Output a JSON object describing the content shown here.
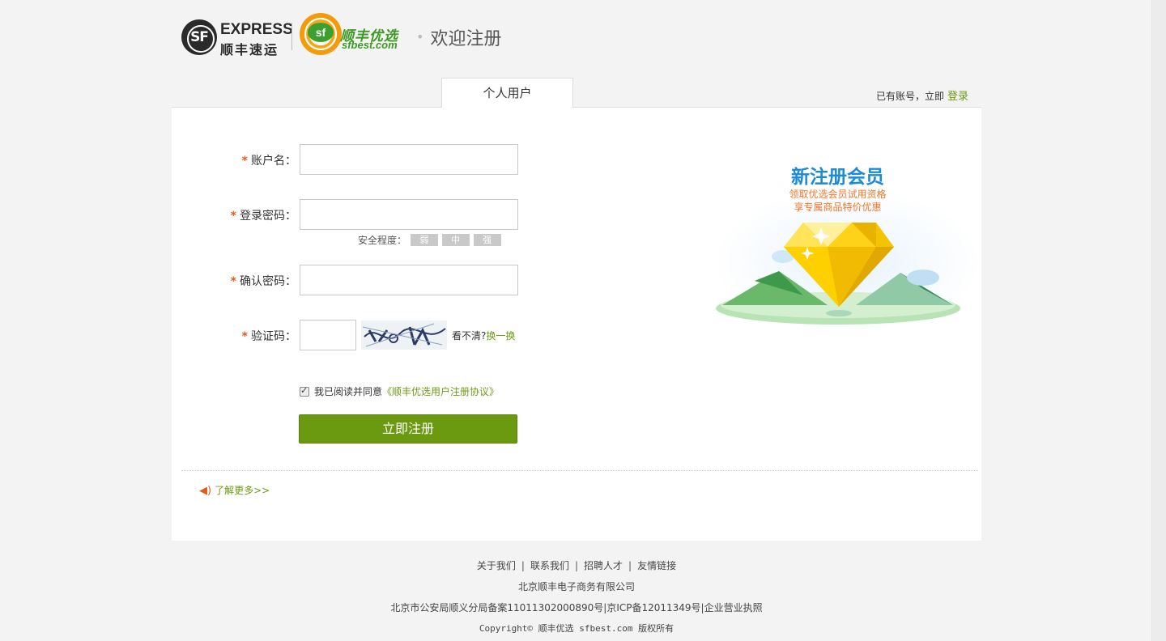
{
  "header": {
    "express_logo_text": "EXPRESS",
    "express_logo_cn": "顺丰速运",
    "sfbest_logo_cn": "顺丰优选",
    "sfbest_logo_url": "sfbest.com",
    "welcome": "欢迎注册"
  },
  "tabs": [
    {
      "label": "个人用户",
      "active": true
    }
  ],
  "login_hint": {
    "text": "已有账号，立即",
    "link": "登录"
  },
  "form": {
    "account": {
      "label": "账户名：",
      "value": ""
    },
    "password": {
      "label": "登录密码：",
      "value": ""
    },
    "strength": {
      "label": "安全程度：",
      "levels": [
        "弱",
        "中",
        "强"
      ]
    },
    "confirm": {
      "label": "确认密码：",
      "value": ""
    },
    "captcha": {
      "label": "验证码：",
      "value": "",
      "hint": "看不清?",
      "refresh": "换一换"
    },
    "agree": {
      "text": "我已阅读并同意",
      "link": "《顺丰优选用户注册协议》",
      "checked": true
    },
    "submit": "立即注册"
  },
  "promo": {
    "title": "新注册会员",
    "line1": "领取优选会员试用资格",
    "line2": "享专属商品特价优惠"
  },
  "more_link": "了解更多>>",
  "footer": {
    "links": [
      "关于我们",
      "联系我们",
      "招聘人才",
      "友情链接"
    ],
    "company": "北京顺丰电子商务有限公司",
    "icp": "北京市公安局顺义分局备案11011302000890号|京ICP备12011349号|企业营业执照",
    "copyright": "Copyright© 顺丰优选 sfbest.com 版权所有"
  },
  "colors": {
    "accent_green": "#6b9a10",
    "star_orange": "#e55a1c",
    "promo_blue": "#1b8bd6"
  }
}
